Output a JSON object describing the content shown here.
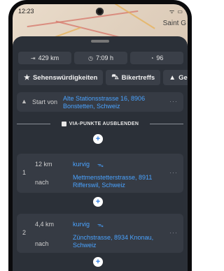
{
  "status": {
    "time": "12:23",
    "icons": "ᯤ ▭"
  },
  "map": {
    "city_label": "Saint G"
  },
  "stats": [
    {
      "icon": "⇥",
      "value": "429 km"
    },
    {
      "icon": "◷",
      "value": "7:09 h"
    },
    {
      "icon": "◔",
      "value": "96"
    }
  ],
  "chips": [
    {
      "icon": "★",
      "label": "Sehenswürdigkeiten"
    },
    {
      "icon": "⛍",
      "label": "Bikertreffs"
    },
    {
      "icon": "▲",
      "label": "Gebi"
    }
  ],
  "start": {
    "label": "Start von",
    "address": "Alte Stationsstrasse 16, 8906 Bonstetten, Schweiz",
    "menu": "···"
  },
  "via_toggle": {
    "label": "VIA-PUNKTE AUSBLENDEN"
  },
  "add_label": "+",
  "waypoints": [
    {
      "number": "1",
      "distance": "12 km",
      "style": "kurvig",
      "style_icon": "ᯓ",
      "nach": "nach",
      "address": "Mettmenstetterstrasse, 8911 Rifferswil, Schweiz",
      "menu": "···"
    },
    {
      "number": "2",
      "distance": "4,4 km",
      "style": "kurvig",
      "style_icon": "ᯓ",
      "nach": "nach",
      "address": "Zünchstrasse, 8934 Knonau, Schweiz",
      "menu": "···"
    }
  ]
}
